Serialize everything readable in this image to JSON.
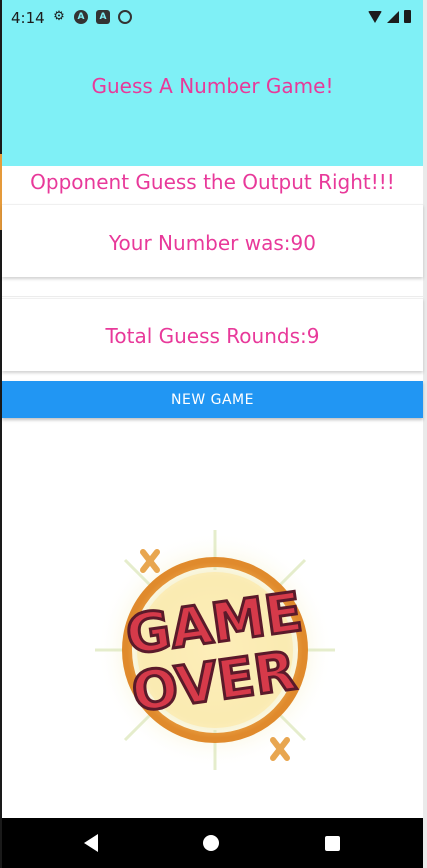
{
  "status_bar": {
    "time": "4:14",
    "icons_left": [
      "settings-icon",
      "a-circle-icon",
      "a-square-icon",
      "sync-icon"
    ],
    "icons_right": [
      "wifi-icon",
      "signal-icon",
      "battery-icon"
    ]
  },
  "header": {
    "title": "Guess A Number Game!",
    "background": "#7ff0f6"
  },
  "result": {
    "message": "Opponent Guess the Output Right!!!",
    "your_number": "Your Number was:90",
    "total_rounds": "Total Guess Rounds:9"
  },
  "actions": {
    "new_game_label": "NEW GAME",
    "button_color": "#2196f3"
  },
  "image": {
    "line1": "GAME",
    "line2": "OVER"
  },
  "nav_bar": {
    "icons": [
      "back-icon",
      "home-icon",
      "recents-icon"
    ]
  },
  "colors": {
    "text_accent": "#e8399a"
  }
}
